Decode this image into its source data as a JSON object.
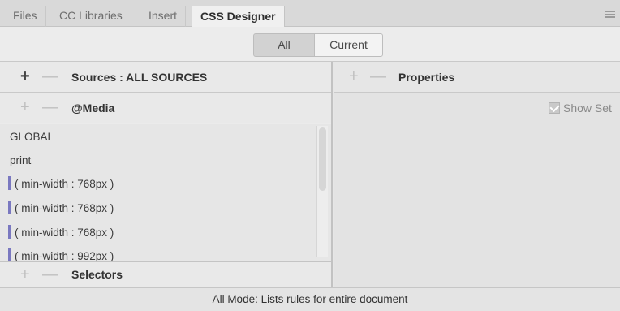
{
  "tabs": [
    {
      "label": "Files",
      "active": false
    },
    {
      "label": "CC Libraries",
      "active": false
    },
    {
      "label": "Insert",
      "active": false
    },
    {
      "label": "CSS Designer",
      "active": true
    }
  ],
  "panel_menu_icon": "hamburger-menu-icon",
  "mode": {
    "all_label": "All",
    "current_label": "Current",
    "selected": "All"
  },
  "sources": {
    "add_symbol": "+",
    "remove_symbol": "—",
    "title": "Sources : ALL SOURCES"
  },
  "media": {
    "add_symbol": "+",
    "remove_symbol": "—",
    "title": "@Media",
    "items": [
      {
        "label": "GLOBAL",
        "marker": false
      },
      {
        "label": "print",
        "marker": false
      },
      {
        "label": "( min-width : 768px )",
        "marker": true
      },
      {
        "label": "( min-width : 768px )",
        "marker": true
      },
      {
        "label": "( min-width : 768px )",
        "marker": true
      },
      {
        "label": "( min-width : 992px )",
        "marker": true
      }
    ],
    "marker_color": "#7a78c0"
  },
  "selectors": {
    "add_symbol": "+",
    "remove_symbol": "—",
    "title": "Selectors"
  },
  "properties": {
    "add_symbol": "+",
    "remove_symbol": "—",
    "title": "Properties",
    "show_set_label": "Show Set",
    "show_set_checked": true
  },
  "status_text": "All Mode: Lists rules for entire document"
}
